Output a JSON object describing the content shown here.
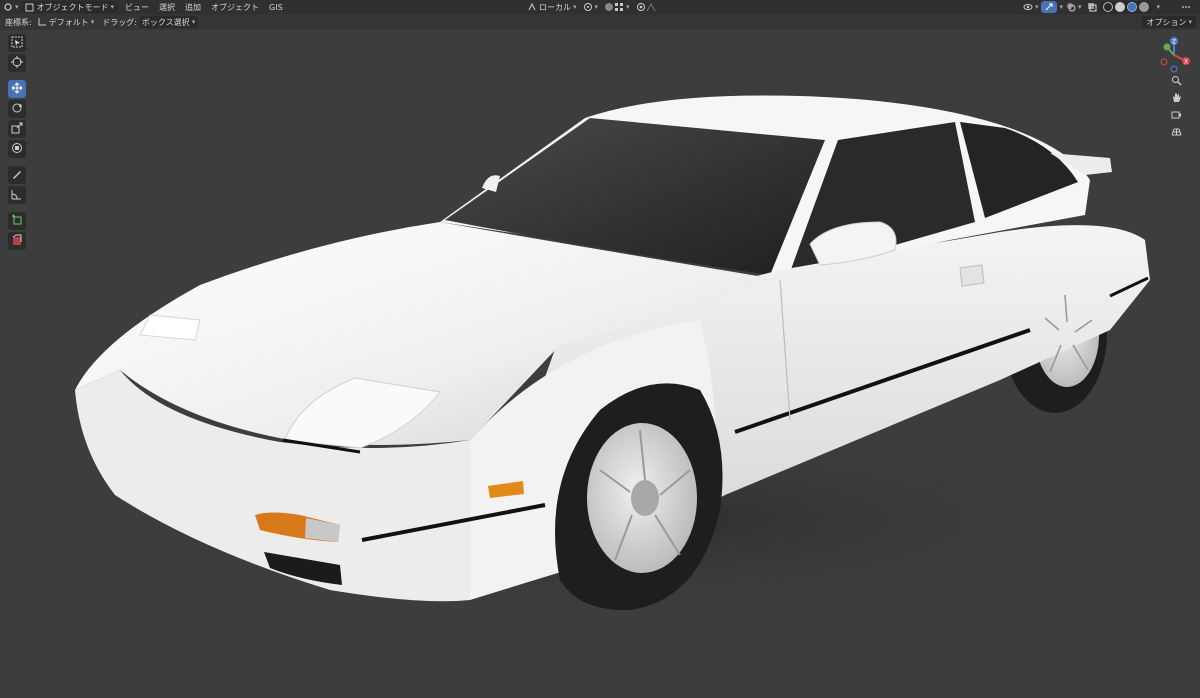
{
  "header": {
    "mode_label": "オブジェクトモード",
    "menus": [
      "ビュー",
      "選択",
      "追加",
      "オブジェクト",
      "GIS"
    ],
    "transform_orientation": "ローカル"
  },
  "subheader": {
    "coord_label": "座標系:",
    "coord_value": "デフォルト",
    "drag_label": "ドラッグ:",
    "drag_value": "ボックス選択",
    "options_label": "オプション"
  },
  "gizmo": {
    "z": "Z",
    "x": "X"
  },
  "colors": {
    "viewport_bg": "#3d3d3d",
    "active_tool": "#4772b3",
    "axis_x": "#e04545",
    "axis_y": "#6aa84f",
    "axis_z": "#4d7fd8"
  }
}
